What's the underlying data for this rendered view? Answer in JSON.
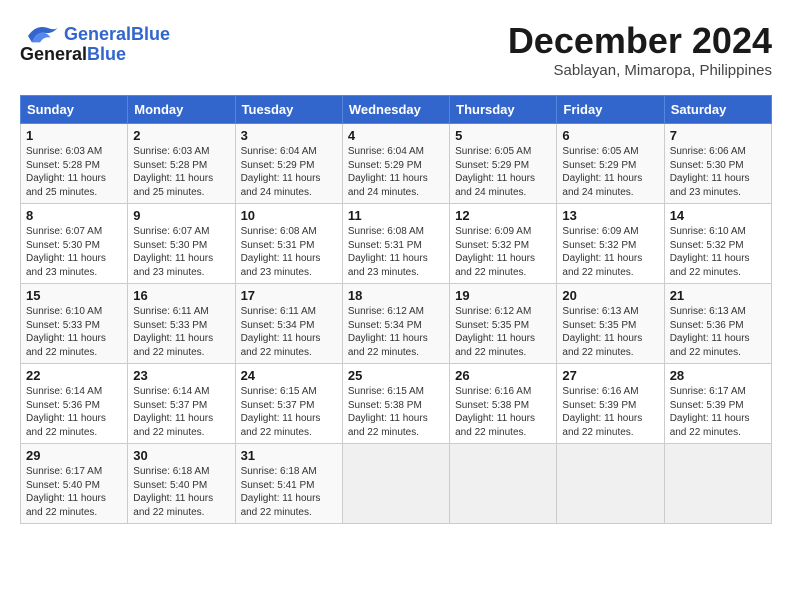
{
  "logo": {
    "text_general": "General",
    "text_blue": "Blue"
  },
  "title": "December 2024",
  "location": "Sablayan, Mimaropa, Philippines",
  "days_of_week": [
    "Sunday",
    "Monday",
    "Tuesday",
    "Wednesday",
    "Thursday",
    "Friday",
    "Saturday"
  ],
  "weeks": [
    [
      {
        "day": "1",
        "sunrise": "6:03 AM",
        "sunset": "5:28 PM",
        "daylight": "11 hours and 25 minutes."
      },
      {
        "day": "2",
        "sunrise": "6:03 AM",
        "sunset": "5:28 PM",
        "daylight": "11 hours and 25 minutes."
      },
      {
        "day": "3",
        "sunrise": "6:04 AM",
        "sunset": "5:29 PM",
        "daylight": "11 hours and 24 minutes."
      },
      {
        "day": "4",
        "sunrise": "6:04 AM",
        "sunset": "5:29 PM",
        "daylight": "11 hours and 24 minutes."
      },
      {
        "day": "5",
        "sunrise": "6:05 AM",
        "sunset": "5:29 PM",
        "daylight": "11 hours and 24 minutes."
      },
      {
        "day": "6",
        "sunrise": "6:05 AM",
        "sunset": "5:29 PM",
        "daylight": "11 hours and 24 minutes."
      },
      {
        "day": "7",
        "sunrise": "6:06 AM",
        "sunset": "5:30 PM",
        "daylight": "11 hours and 23 minutes."
      }
    ],
    [
      {
        "day": "8",
        "sunrise": "6:07 AM",
        "sunset": "5:30 PM",
        "daylight": "11 hours and 23 minutes."
      },
      {
        "day": "9",
        "sunrise": "6:07 AM",
        "sunset": "5:30 PM",
        "daylight": "11 hours and 23 minutes."
      },
      {
        "day": "10",
        "sunrise": "6:08 AM",
        "sunset": "5:31 PM",
        "daylight": "11 hours and 23 minutes."
      },
      {
        "day": "11",
        "sunrise": "6:08 AM",
        "sunset": "5:31 PM",
        "daylight": "11 hours and 23 minutes."
      },
      {
        "day": "12",
        "sunrise": "6:09 AM",
        "sunset": "5:32 PM",
        "daylight": "11 hours and 22 minutes."
      },
      {
        "day": "13",
        "sunrise": "6:09 AM",
        "sunset": "5:32 PM",
        "daylight": "11 hours and 22 minutes."
      },
      {
        "day": "14",
        "sunrise": "6:10 AM",
        "sunset": "5:32 PM",
        "daylight": "11 hours and 22 minutes."
      }
    ],
    [
      {
        "day": "15",
        "sunrise": "6:10 AM",
        "sunset": "5:33 PM",
        "daylight": "11 hours and 22 minutes."
      },
      {
        "day": "16",
        "sunrise": "6:11 AM",
        "sunset": "5:33 PM",
        "daylight": "11 hours and 22 minutes."
      },
      {
        "day": "17",
        "sunrise": "6:11 AM",
        "sunset": "5:34 PM",
        "daylight": "11 hours and 22 minutes."
      },
      {
        "day": "18",
        "sunrise": "6:12 AM",
        "sunset": "5:34 PM",
        "daylight": "11 hours and 22 minutes."
      },
      {
        "day": "19",
        "sunrise": "6:12 AM",
        "sunset": "5:35 PM",
        "daylight": "11 hours and 22 minutes."
      },
      {
        "day": "20",
        "sunrise": "6:13 AM",
        "sunset": "5:35 PM",
        "daylight": "11 hours and 22 minutes."
      },
      {
        "day": "21",
        "sunrise": "6:13 AM",
        "sunset": "5:36 PM",
        "daylight": "11 hours and 22 minutes."
      }
    ],
    [
      {
        "day": "22",
        "sunrise": "6:14 AM",
        "sunset": "5:36 PM",
        "daylight": "11 hours and 22 minutes."
      },
      {
        "day": "23",
        "sunrise": "6:14 AM",
        "sunset": "5:37 PM",
        "daylight": "11 hours and 22 minutes."
      },
      {
        "day": "24",
        "sunrise": "6:15 AM",
        "sunset": "5:37 PM",
        "daylight": "11 hours and 22 minutes."
      },
      {
        "day": "25",
        "sunrise": "6:15 AM",
        "sunset": "5:38 PM",
        "daylight": "11 hours and 22 minutes."
      },
      {
        "day": "26",
        "sunrise": "6:16 AM",
        "sunset": "5:38 PM",
        "daylight": "11 hours and 22 minutes."
      },
      {
        "day": "27",
        "sunrise": "6:16 AM",
        "sunset": "5:39 PM",
        "daylight": "11 hours and 22 minutes."
      },
      {
        "day": "28",
        "sunrise": "6:17 AM",
        "sunset": "5:39 PM",
        "daylight": "11 hours and 22 minutes."
      }
    ],
    [
      {
        "day": "29",
        "sunrise": "6:17 AM",
        "sunset": "5:40 PM",
        "daylight": "11 hours and 22 minutes."
      },
      {
        "day": "30",
        "sunrise": "6:18 AM",
        "sunset": "5:40 PM",
        "daylight": "11 hours and 22 minutes."
      },
      {
        "day": "31",
        "sunrise": "6:18 AM",
        "sunset": "5:41 PM",
        "daylight": "11 hours and 22 minutes."
      },
      null,
      null,
      null,
      null
    ]
  ]
}
